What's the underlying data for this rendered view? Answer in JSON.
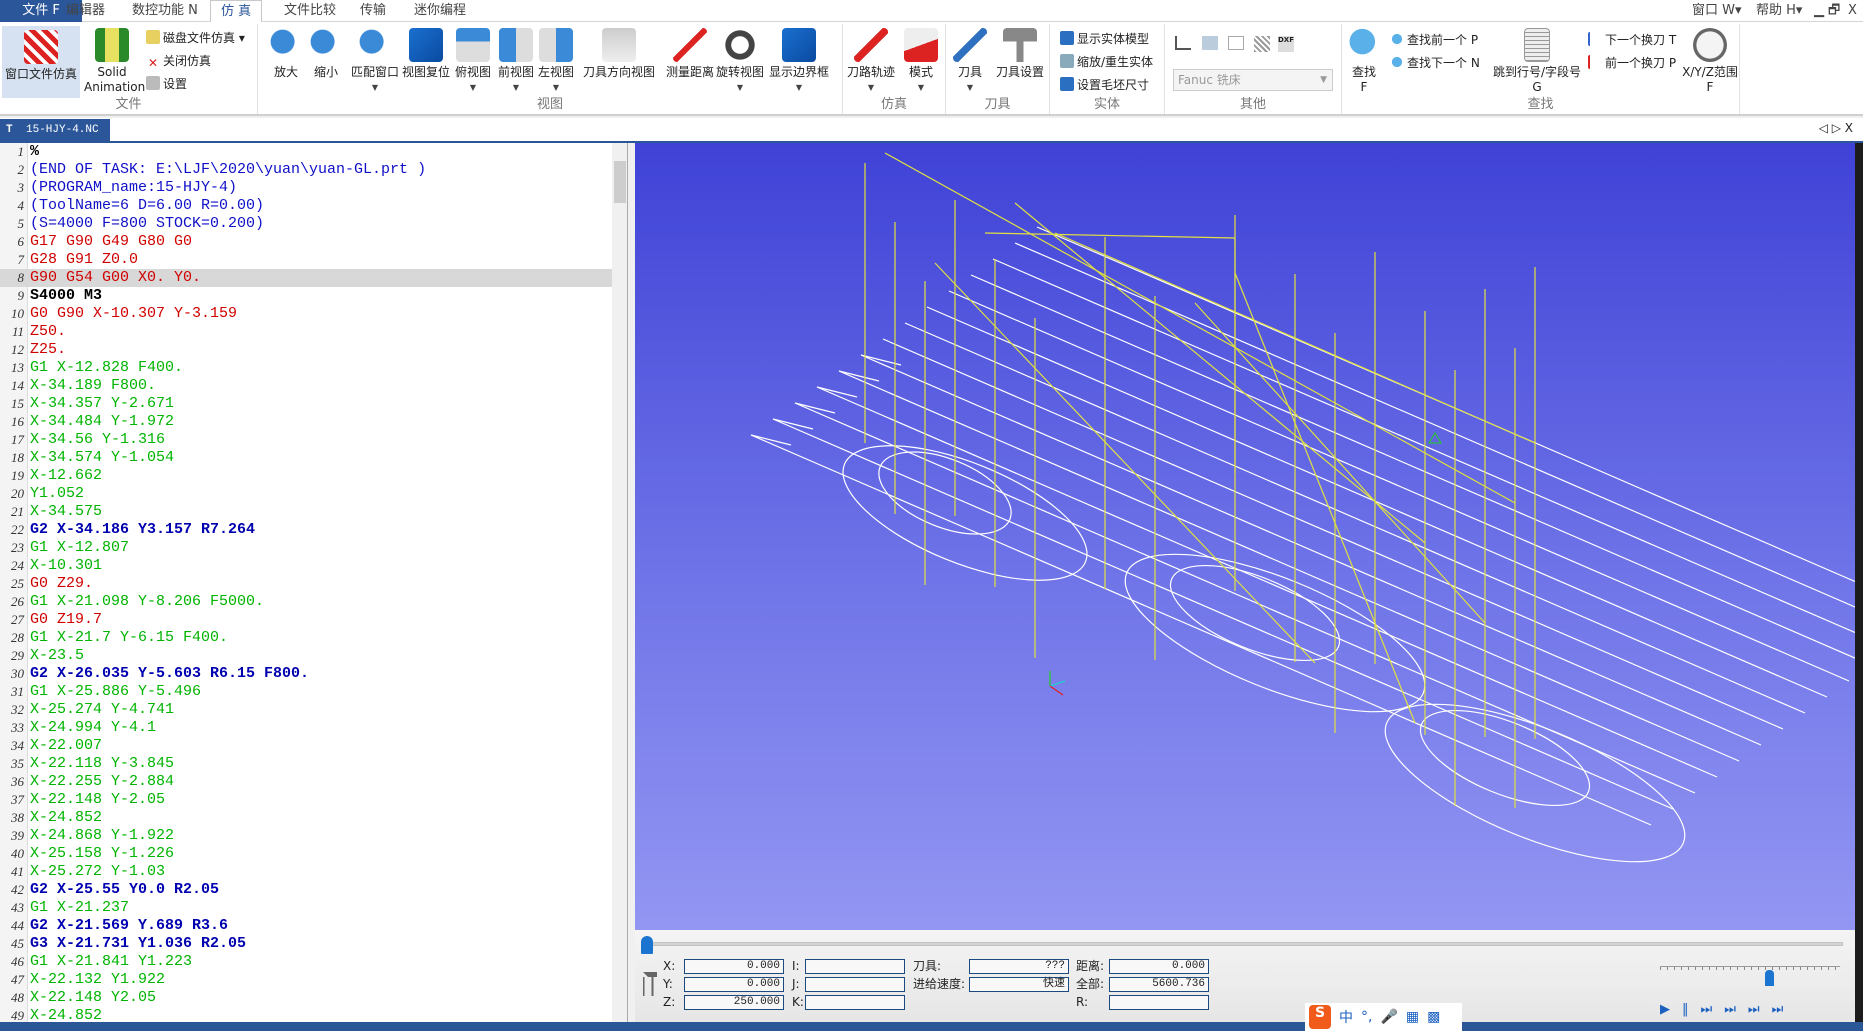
{
  "menubar": {
    "tabs": [
      "文件 F",
      "编辑器",
      "数控功能 N",
      "仿 真",
      "文件比较",
      "传输",
      "迷你编程"
    ],
    "right": [
      "窗口 W▾",
      "帮助 H▾",
      "▁",
      "🗗",
      "X"
    ]
  },
  "ribbon": {
    "file_group": {
      "label": "文件",
      "window_sim": "窗口文件仿真",
      "solid_anim_1": "Solid",
      "solid_anim_2": "Animation",
      "disk_sim": "磁盘文件仿真 ▾",
      "close_sim": "关闭仿真",
      "settings": "设置"
    },
    "view_group": {
      "label": "视图",
      "buttons": [
        "放大",
        "缩小",
        "匹配窗口",
        "视图复位",
        "俯视图",
        "前视图",
        "左视图",
        "刀具方向视图",
        "测量距离",
        "旋转视图",
        "显示边界框"
      ]
    },
    "sim_group": {
      "label": "仿真",
      "buttons": [
        "刀路轨迹",
        "模式"
      ]
    },
    "tool_group": {
      "label": "刀具",
      "buttons": [
        "刀具",
        "刀具设置"
      ]
    },
    "solid_group": {
      "label": "实体",
      "items": [
        "显示实体模型",
        "缩放/重生实体",
        "设置毛坯尺寸"
      ]
    },
    "other_group": {
      "label": "其他",
      "machine_select": "Fanuc 铣床"
    },
    "find_group": {
      "label": "查找",
      "find_1": "查找",
      "find_2": "F",
      "find_prev": "查找前一个 P",
      "find_next": "查找下一个 N",
      "goto_1": "跳到行号/字段号",
      "goto_2": "G",
      "next_tool": "下一个换刀 T",
      "prev_tool": "前一个换刀 P",
      "range_1": "X/Y/Z范围",
      "range_2": "F"
    }
  },
  "doc_tab": {
    "name": "15-HJY-4.NC",
    "nav": "◁ ▷ X"
  },
  "code": {
    "current_line": 8,
    "lines": [
      {
        "t": "%",
        "c": "black"
      },
      {
        "t": "(END OF TASK: E:\\LJF\\2020\\yuan\\yuan-GL.prt )",
        "c": "blue"
      },
      {
        "t": "(PROGRAM_name:15-HJY-4)",
        "c": "blue"
      },
      {
        "t": "(ToolName=6 D=6.00 R=0.00)",
        "c": "blue"
      },
      {
        "t": "(S=4000 F=800 STOCK=0.200)",
        "c": "blue"
      },
      {
        "t": "G17 G90 G49 G80 G0",
        "c": "red"
      },
      {
        "t": "G28 G91 Z0.0",
        "c": "red"
      },
      {
        "t": "G90 G54 G00 X0. Y0.",
        "c": "red"
      },
      {
        "t": "S4000 M3",
        "c": "black"
      },
      {
        "t": "G0 G90 X-10.307 Y-3.159",
        "c": "red"
      },
      {
        "t": "Z50.",
        "c": "red"
      },
      {
        "t": "Z25.",
        "c": "red"
      },
      {
        "t": "G1 X-12.828 F400.",
        "c": "green"
      },
      {
        "t": "X-34.189 F800.",
        "c": "green"
      },
      {
        "t": "X-34.357 Y-2.671",
        "c": "green"
      },
      {
        "t": "X-34.484 Y-1.972",
        "c": "green"
      },
      {
        "t": "X-34.56 Y-1.316",
        "c": "green"
      },
      {
        "t": "X-34.574 Y-1.054",
        "c": "green"
      },
      {
        "t": "X-12.662",
        "c": "green"
      },
      {
        "t": "Y1.052",
        "c": "green"
      },
      {
        "t": "X-34.575",
        "c": "green"
      },
      {
        "t": "G2 X-34.186 Y3.157 R7.264",
        "c": "dblue"
      },
      {
        "t": "G1 X-12.807",
        "c": "green"
      },
      {
        "t": "X-10.301",
        "c": "green"
      },
      {
        "t": "G0 Z29.",
        "c": "red"
      },
      {
        "t": "G1 X-21.098 Y-8.206 F5000.",
        "c": "green"
      },
      {
        "t": "G0 Z19.7",
        "c": "red"
      },
      {
        "t": "G1 X-21.7 Y-6.15 F400.",
        "c": "green"
      },
      {
        "t": "X-23.5",
        "c": "green"
      },
      {
        "t": "G2 X-26.035 Y-5.603 R6.15 F800.",
        "c": "dblue"
      },
      {
        "t": "G1 X-25.886 Y-5.496",
        "c": "green"
      },
      {
        "t": "X-25.274 Y-4.741",
        "c": "green"
      },
      {
        "t": "X-24.994 Y-4.1",
        "c": "green"
      },
      {
        "t": "X-22.007",
        "c": "green"
      },
      {
        "t": "X-22.118 Y-3.845",
        "c": "green"
      },
      {
        "t": "X-22.255 Y-2.884",
        "c": "green"
      },
      {
        "t": "X-22.148 Y-2.05",
        "c": "green"
      },
      {
        "t": "X-24.852",
        "c": "green"
      },
      {
        "t": "X-24.868 Y-1.922",
        "c": "green"
      },
      {
        "t": "X-25.158 Y-1.226",
        "c": "green"
      },
      {
        "t": "X-25.272 Y-1.03",
        "c": "green"
      },
      {
        "t": "G2 X-25.55 Y0.0 R2.05",
        "c": "dblue"
      },
      {
        "t": "G1 X-21.237",
        "c": "green"
      },
      {
        "t": "G2 X-21.569 Y.689 R3.6",
        "c": "dblue"
      },
      {
        "t": "G3 X-21.731 Y1.036 R2.05",
        "c": "dblue"
      },
      {
        "t": "G1 X-21.841 Y1.223",
        "c": "green"
      },
      {
        "t": "X-22.132 Y1.922",
        "c": "green"
      },
      {
        "t": "X-22.148 Y2.05",
        "c": "green"
      },
      {
        "t": "X-24.852",
        "c": "green"
      }
    ]
  },
  "colors": {
    "toolpath_feed": "#ffffff",
    "toolpath_rapid": "#e0e040",
    "viewport_top": "#3f42d6",
    "viewport_bottom": "#9396f2",
    "accent": "#2b579a"
  },
  "readout": {
    "x_label": "X:",
    "x": "0.000",
    "y_label": "Y:",
    "y": "0.000",
    "z_label": "Z:",
    "z": "250.000",
    "i_label": "I:",
    "i": "",
    "j_label": "J:",
    "j": "",
    "k_label": "K:",
    "k": "",
    "tool_label": "刀具:",
    "tool": "???",
    "feed_label": "进给速度:",
    "feed": "快速",
    "dist_label": "距离:",
    "dist": "0.000",
    "total_label": "全部:",
    "total": "5600.736",
    "r_label": "R:",
    "r": ""
  },
  "sim_progress": 0,
  "speed_level": 0.6,
  "ime": {
    "logo": "S",
    "items": [
      "中",
      "°,",
      "🎤",
      "▦",
      "▩"
    ]
  }
}
